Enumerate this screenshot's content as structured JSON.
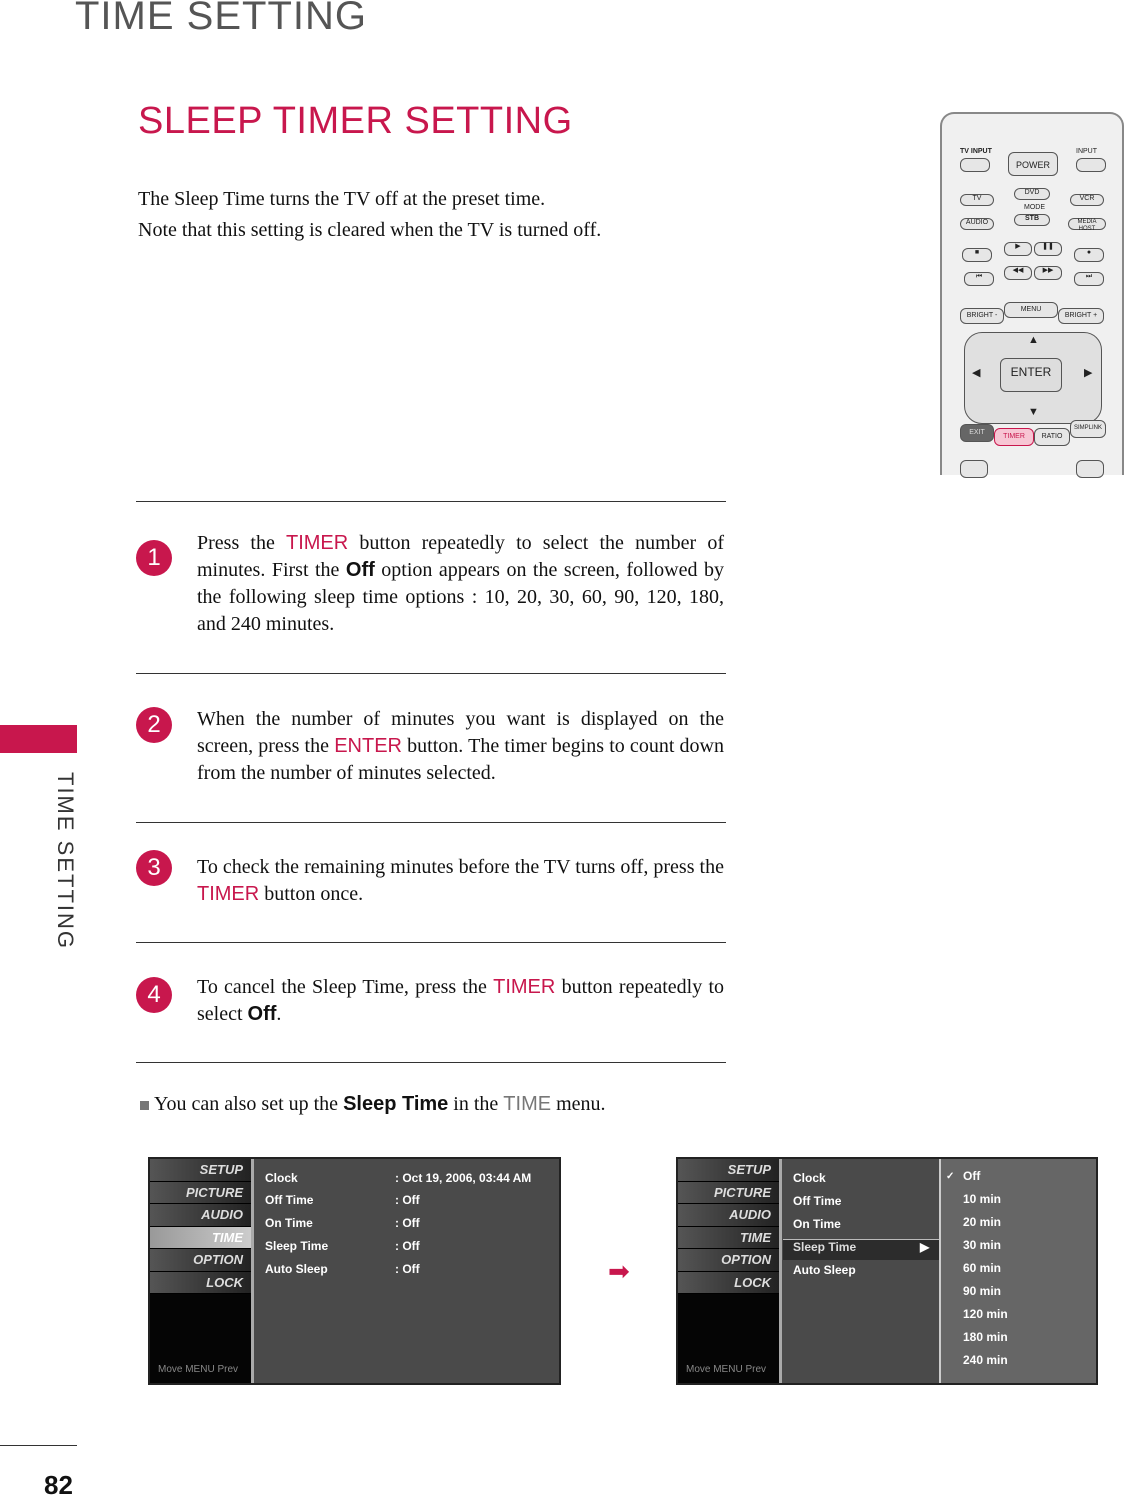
{
  "header": {
    "section": "TIME SETTING",
    "side_tab": "TIME SETTING",
    "page_number": "82"
  },
  "title": "SLEEP TIMER SETTING",
  "intro": [
    "The Sleep Time turns the TV off at the preset time.",
    "Note that this setting is cleared when the TV is turned off."
  ],
  "accent_color": "#c8174d",
  "steps": [
    {
      "n": "1",
      "a": "Press the ",
      "k1": "TIMER",
      "b": " button repeatedly to select the number of minutes. First the ",
      "k2": "Off",
      "c": " option appears on the screen, followed by the following sleep time options : 10, 20, 30, 60, 90, 120, 180, and 240 minutes."
    },
    {
      "n": "2",
      "a": "When the number of minutes you want is displayed on the screen, press the ",
      "k1": "ENTER",
      "b": " button. The timer begins to count down from the number of minutes selected."
    },
    {
      "n": "3",
      "a": "To check the remaining minutes before the TV turns off, press the ",
      "k1": "TIMER",
      "b": " button once."
    },
    {
      "n": "4",
      "a": "To cancel the Sleep Time, press the ",
      "k1": "TIMER",
      "b": " button repeatedly to select ",
      "k2": "Off",
      "c": "."
    }
  ],
  "note": {
    "a": "You can also set up the ",
    "k1": "Sleep Time",
    "b": " in the ",
    "k2": "TIME",
    "c": " menu."
  },
  "osd": {
    "side_items": [
      "SETUP",
      "PICTURE",
      "AUDIO",
      "TIME",
      "OPTION",
      "LOCK"
    ],
    "footer": "Move   MENU Prev",
    "items": [
      "Clock",
      "Off Time",
      "On Time",
      "Sleep Time",
      "Auto Sleep"
    ],
    "values": [
      ": Oct 19, 2006, 03:44 AM",
      ": Off",
      ": Off",
      ": Off",
      ": Off"
    ],
    "options": [
      "Off",
      "10 min",
      "20 min",
      "30 min",
      "60 min",
      "90 min",
      "120 min",
      "180 min",
      "240 min"
    ],
    "selected_option": "Off"
  },
  "remote": {
    "buttons": [
      "TV INPUT",
      "POWER",
      "INPUT",
      "TV",
      "DVD",
      "VCR",
      "MODE",
      "AUDIO",
      "STB",
      "MEDIA HOST",
      "■",
      "▶",
      "❚❚",
      "●",
      "⏮",
      "◀◀",
      "▶▶",
      "⏭",
      "BRIGHT -",
      "MENU",
      "BRIGHT +",
      "▲",
      "◀",
      "ENTER",
      "▶",
      "▼",
      "EXIT",
      "TIMER",
      "RATIO",
      "SIMPLINK"
    ]
  }
}
